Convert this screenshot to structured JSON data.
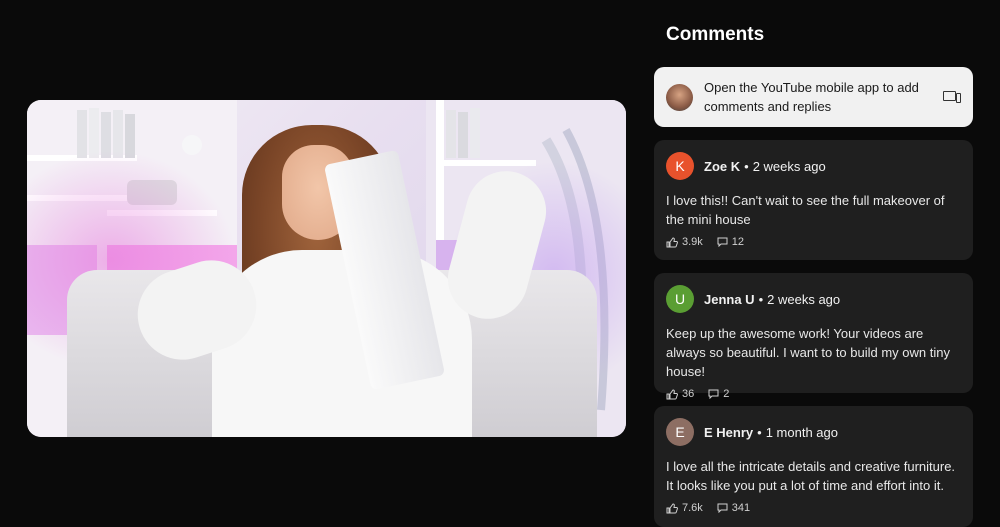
{
  "comments_panel": {
    "title": "Comments",
    "prompt": {
      "text": "Open the YouTube mobile app to add comments and replies",
      "avatar_icon": "user-avatar-icon",
      "device_icon": "devices-icon"
    },
    "items": [
      {
        "initial": "K",
        "avatar_color": "#e8522c",
        "author": "Zoe K",
        "time": "2 weeks ago",
        "text": "I love this!! Can't wait to see the full makeover of the mini house",
        "likes": "3.9k",
        "replies": "12"
      },
      {
        "initial": "U",
        "avatar_color": "#5a9e33",
        "author": "Jenna U",
        "time": "2 weeks ago",
        "text": "Keep up the awesome work! Your videos are always so beautiful. I want to to build my own tiny house!",
        "likes": "36",
        "replies": "2"
      },
      {
        "initial": "E",
        "avatar_color": "#8d6e63",
        "author": "E Henry",
        "time": "1 month ago",
        "text": "I love all the intricate details and creative furniture. It looks like you put a lot of time and effort into it.",
        "likes": "7.6k",
        "replies": "341"
      }
    ],
    "separator": "•"
  }
}
